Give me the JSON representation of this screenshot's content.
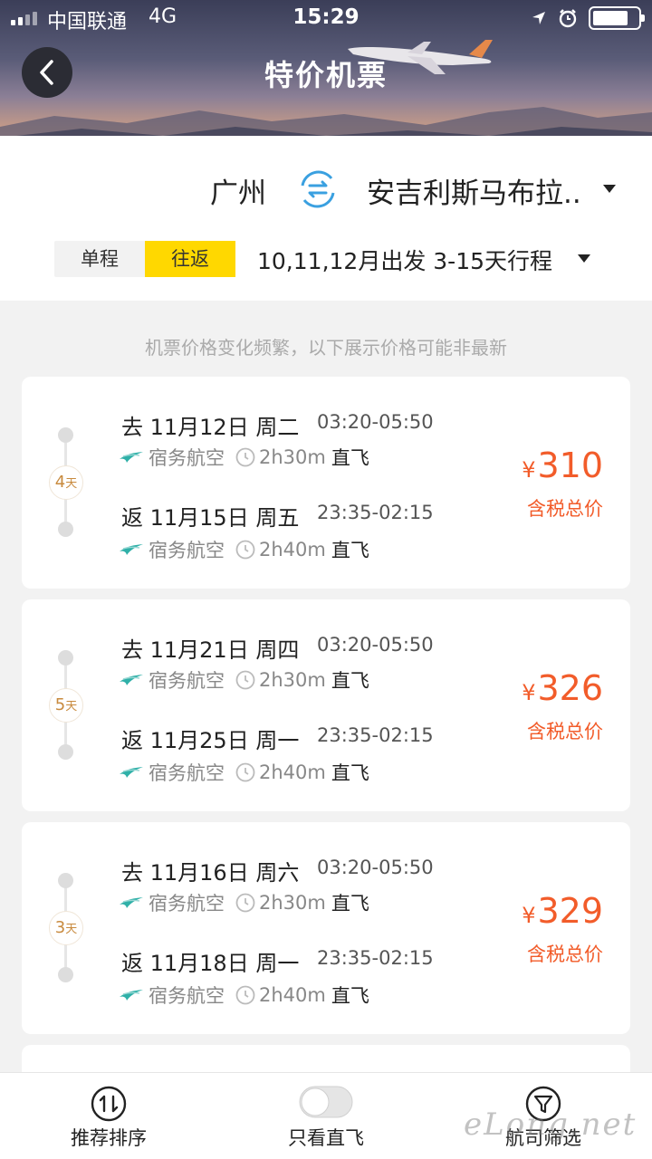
{
  "status_bar": {
    "carrier": "中国联通",
    "network": "4G",
    "time": "15:29"
  },
  "header": {
    "title": "特价机票"
  },
  "route": {
    "from": "广州",
    "to": "安吉利斯马布拉.."
  },
  "trip_type": {
    "one_way": "单程",
    "round_trip": "往返",
    "selected": "往返"
  },
  "departure_range": "10,11,12月出发 3-15天行程",
  "notice": "机票价格变化频繁，以下展示价格可能非最新",
  "flights": [
    {
      "days": "4",
      "days_unit": "天",
      "outbound": {
        "label": "去 11月12日 周二",
        "time": "03:20-05:50",
        "airline": "宿务航空",
        "duration": "2h30m",
        "type": "直飞"
      },
      "return": {
        "label": "返 11月15日 周五",
        "time": "23:35-02:15",
        "airline": "宿务航空",
        "duration": "2h40m",
        "type": "直飞"
      },
      "currency": "¥",
      "price": "310",
      "price_note": "含税总价"
    },
    {
      "days": "5",
      "days_unit": "天",
      "outbound": {
        "label": "去 11月21日 周四",
        "time": "03:20-05:50",
        "airline": "宿务航空",
        "duration": "2h30m",
        "type": "直飞"
      },
      "return": {
        "label": "返 11月25日 周一",
        "time": "23:35-02:15",
        "airline": "宿务航空",
        "duration": "2h40m",
        "type": "直飞"
      },
      "currency": "¥",
      "price": "326",
      "price_note": "含税总价"
    },
    {
      "days": "3",
      "days_unit": "天",
      "outbound": {
        "label": "去 11月16日 周六",
        "time": "03:20-05:50",
        "airline": "宿务航空",
        "duration": "2h30m",
        "type": "直飞"
      },
      "return": {
        "label": "返 11月18日 周一",
        "time": "23:35-02:15",
        "airline": "宿务航空",
        "duration": "2h40m",
        "type": "直飞"
      },
      "currency": "¥",
      "price": "329",
      "price_note": "含税总价"
    }
  ],
  "bottom_bar": {
    "sort": "推荐排序",
    "direct_only": "只看直飞",
    "airline_filter": "航司筛选"
  },
  "watermark": "eLong.net",
  "colors": {
    "accent_yellow": "#ffd800",
    "price_orange": "#f25c2a",
    "swap_blue": "#3aa0e0",
    "duration_badge": "#c88a3e"
  }
}
